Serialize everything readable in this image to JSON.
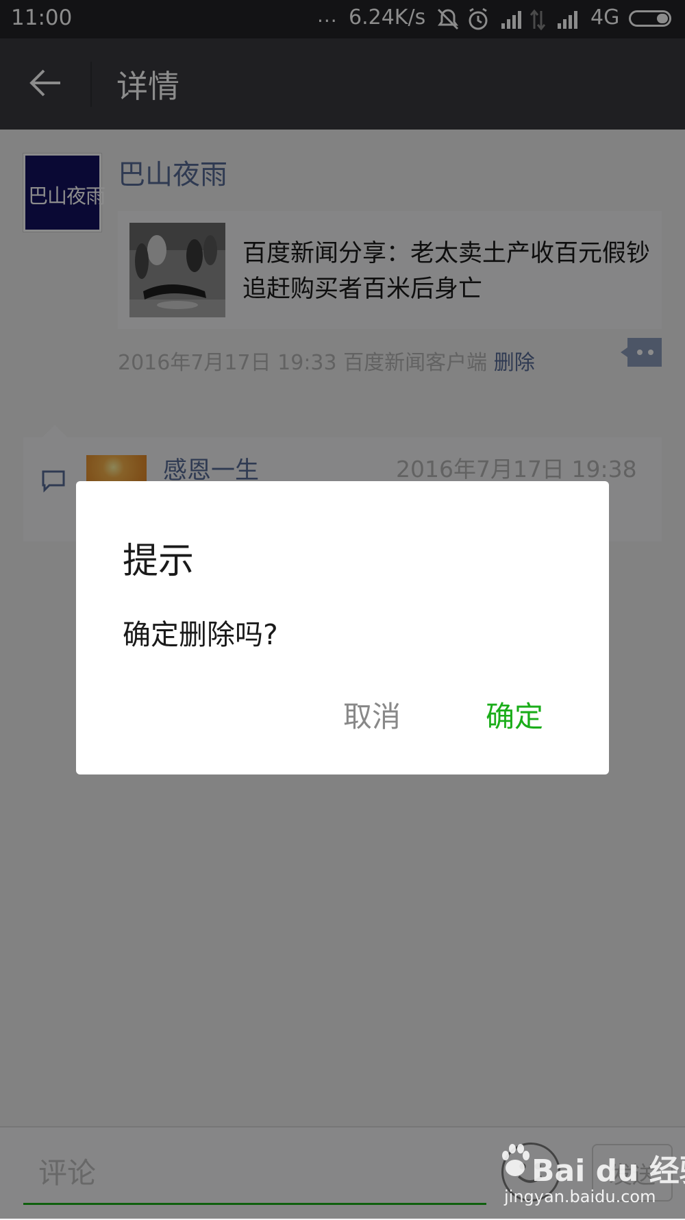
{
  "status_bar": {
    "time": "11:00",
    "dots": "...",
    "speed": "6.24K/s",
    "network": "4G",
    "icons": [
      "mute-icon",
      "alarm-icon",
      "signal-icon",
      "data-arrows-icon",
      "signal-icon"
    ]
  },
  "nav": {
    "title": "详情"
  },
  "post": {
    "avatar_text": "巴山夜雨",
    "username": "巴山夜雨",
    "card_title": "百度新闻分享：老太卖土产收百元假钞 追赶购买者百米后身亡",
    "timestamp": "2016年7月17日 19:33",
    "source": "百度新闻客户端",
    "delete_label": "删除"
  },
  "comment": {
    "name": "感恩一生",
    "time": "2016年7月17日 19:38"
  },
  "bottom_bar": {
    "placeholder": "评论",
    "send_label": "发送"
  },
  "dialog": {
    "title": "提示",
    "message": "确定删除吗?",
    "cancel_label": "取消",
    "confirm_label": "确定"
  },
  "watermark": {
    "brand": "Bai du 经验",
    "url": "jingyan.baidu.com"
  },
  "colors": {
    "accent_green": "#1aad19",
    "link_blue": "#576b95",
    "nav_background": "#393a3f"
  }
}
